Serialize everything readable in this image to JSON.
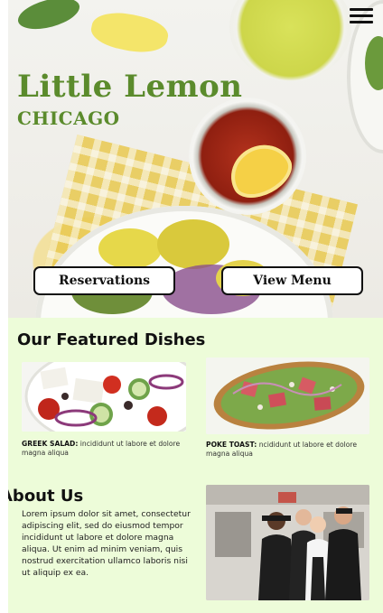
{
  "hero": {
    "title": "Little Lemon",
    "subtitle": "CHICAGO",
    "reservations_label": "Reservations",
    "view_menu_label": "View Menu"
  },
  "nav": {
    "menu_icon": "hamburger-menu-icon"
  },
  "featured": {
    "heading": "Our Featured Dishes",
    "dishes": [
      {
        "name": "GREEK SALAD:",
        "description": " incididunt ut labore et dolore magna aliqua"
      },
      {
        "name": "POKE TOAST:",
        "description": " ncididunt ut labore et dolore magna aliqua"
      }
    ]
  },
  "about": {
    "heading": "About Us",
    "body": "Lorem ipsum dolor sit amet, consectetur adipiscing elit, sed do eiusmod tempor incididunt ut labore et dolore magna aliqua. Ut enim ad minim veniam, quis nostrud exercitation ullamco laboris nisi ut aliquip ex ea."
  },
  "colors": {
    "brand_green": "#5b8b2c",
    "section_bg": "#edfcd9"
  }
}
